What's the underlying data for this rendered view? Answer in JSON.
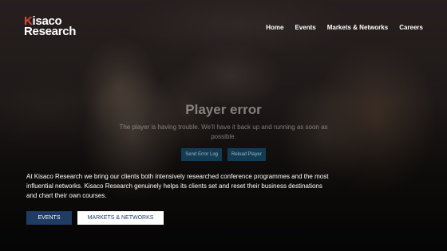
{
  "header": {
    "logo_line1_accent": "K",
    "logo_line1_rest": "isaco",
    "logo_line2": "Research",
    "nav": [
      {
        "label": "Home"
      },
      {
        "label": "Events"
      },
      {
        "label": "Markets & Networks"
      },
      {
        "label": "Careers"
      }
    ]
  },
  "player_error": {
    "title": "Player error",
    "message": "The player is having trouble. We'll have it back up and running as soon as possible.",
    "buttons": [
      {
        "label": "Send Error Log"
      },
      {
        "label": "Reload Player"
      }
    ]
  },
  "intro": {
    "text": "At Kisaco Research we bring our clients both intensively researched conference programmes and the most influential networks. Kisaco Research genuinely helps its clients set and reset their business destinations and chart their own courses."
  },
  "cta": {
    "events_label": "EVENTS",
    "markets_label": "MARKETS & NETWORKS"
  },
  "colors": {
    "brand_red": "#e2433a",
    "navy": "#1f3c63",
    "player_button": "#12415c"
  }
}
